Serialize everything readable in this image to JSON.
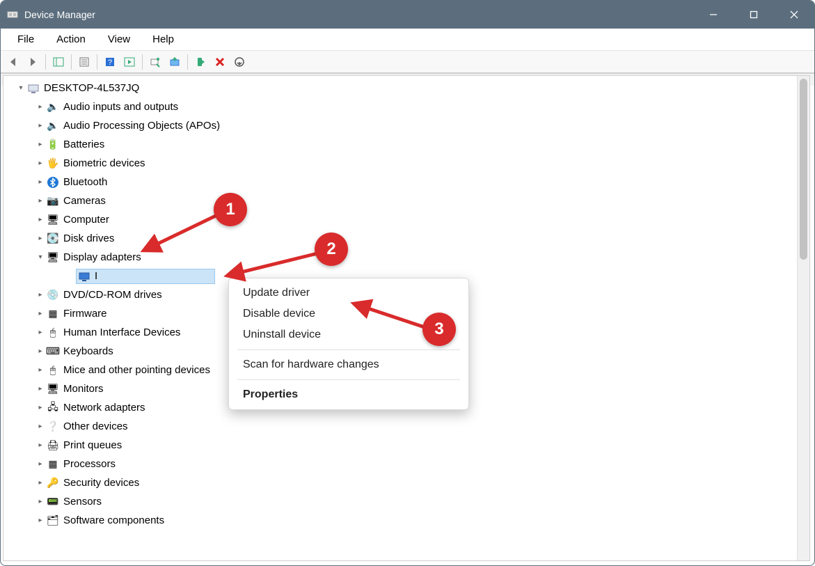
{
  "title": "Device Manager",
  "menu": {
    "file": "File",
    "action": "Action",
    "view": "View",
    "help": "Help"
  },
  "root_label": "DESKTOP-4L537JQ",
  "categories": [
    {
      "label": "Audio inputs and outputs",
      "icon": "speaker-icon"
    },
    {
      "label": "Audio Processing Objects (APOs)",
      "icon": "speaker-icon"
    },
    {
      "label": "Batteries",
      "icon": "battery-icon"
    },
    {
      "label": "Biometric devices",
      "icon": "fingerprint-icon"
    },
    {
      "label": "Bluetooth",
      "icon": "bluetooth-icon"
    },
    {
      "label": "Cameras",
      "icon": "camera-icon"
    },
    {
      "label": "Computer",
      "icon": "monitor-icon"
    },
    {
      "label": "Disk drives",
      "icon": "disk-icon"
    },
    {
      "label": "Display adapters",
      "icon": "display-icon",
      "expanded": true
    },
    {
      "label": "DVD/CD-ROM drives",
      "icon": "cd-icon"
    },
    {
      "label": "Firmware",
      "icon": "chip-icon"
    },
    {
      "label": "Human Interface Devices",
      "icon": "hid-icon"
    },
    {
      "label": "Keyboards",
      "icon": "keyboard-icon"
    },
    {
      "label": "Mice and other pointing devices",
      "icon": "mouse-icon"
    },
    {
      "label": "Monitors",
      "icon": "monitor-icon"
    },
    {
      "label": "Network adapters",
      "icon": "network-icon"
    },
    {
      "label": "Other devices",
      "icon": "other-icon"
    },
    {
      "label": "Print queues",
      "icon": "printer-icon"
    },
    {
      "label": "Processors",
      "icon": "cpu-icon"
    },
    {
      "label": "Security devices",
      "icon": "security-icon"
    },
    {
      "label": "Sensors",
      "icon": "sensor-icon"
    },
    {
      "label": "Software components",
      "icon": "software-icon"
    }
  ],
  "selected_device_prefix": "I",
  "context_menu": {
    "update": "Update driver",
    "disable": "Disable device",
    "uninstall": "Uninstall device",
    "scan": "Scan for hardware changes",
    "properties": "Properties"
  },
  "markers": {
    "m1": "1",
    "m2": "2",
    "m3": "3"
  },
  "icon_glyph": {
    "speaker-icon": "🔈",
    "battery-icon": "🔋",
    "fingerprint-icon": "🖐",
    "bluetooth-icon": "ᚼ",
    "camera-icon": "📷",
    "monitor-icon": "🖥",
    "disk-icon": "💽",
    "display-icon": "🖥",
    "cd-icon": "💿",
    "chip-icon": "▦",
    "hid-icon": "🖱",
    "keyboard-icon": "⌨",
    "mouse-icon": "🖱",
    "network-icon": "🖧",
    "other-icon": "❔",
    "printer-icon": "🖨",
    "cpu-icon": "▦",
    "security-icon": "🔑",
    "sensor-icon": "📟",
    "software-icon": "🗂",
    "computer-root-icon": "🖥"
  }
}
